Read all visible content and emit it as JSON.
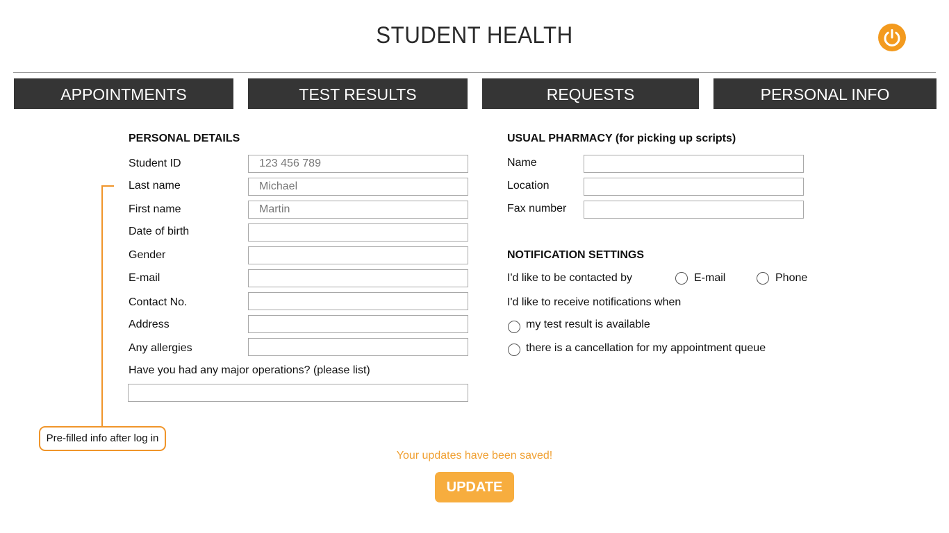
{
  "header": {
    "title": "STUDENT HEALTH",
    "power_icon": "power-icon",
    "accent_color": "#f39a1e"
  },
  "nav": {
    "tabs": [
      {
        "label": "APPOINTMENTS"
      },
      {
        "label": "TEST RESULTS"
      },
      {
        "label": "REQUESTS"
      },
      {
        "label": "PERSONAL INFO"
      }
    ]
  },
  "personal": {
    "heading": "PERSONAL DETAILS",
    "fields": [
      {
        "label": "Student ID",
        "value": "123 456 789"
      },
      {
        "label": "Last name",
        "value": "Michael"
      },
      {
        "label": "First name",
        "value": "Martin"
      },
      {
        "label": "Date of birth",
        "value": ""
      },
      {
        "label": "Gender",
        "value": ""
      },
      {
        "label": "E-mail",
        "value": ""
      },
      {
        "label": "Contact No.",
        "value": ""
      },
      {
        "label": "Address",
        "value": ""
      },
      {
        "label": "Any allergies",
        "value": ""
      }
    ],
    "operations_label": "Have you had any major operations? (please list)",
    "operations_value": ""
  },
  "pharmacy": {
    "heading": "USUAL PHARMACY (for picking up scripts)",
    "fields": [
      {
        "label": "Name",
        "value": ""
      },
      {
        "label": "Location",
        "value": ""
      },
      {
        "label": "Fax number",
        "value": ""
      }
    ]
  },
  "notifications": {
    "heading": "NOTIFICATION SETTINGS",
    "contact_label": "I'd like to be contacted by",
    "contact_options": [
      "E-mail",
      "Phone"
    ],
    "receive_label": "I'd like to receive notifications when",
    "receive_options": [
      "my test result is available",
      "there is a cancellation for my appointment queue"
    ]
  },
  "callout": {
    "text": "Pre-filled info after log in"
  },
  "footer": {
    "saved_message": "Your updates have been saved!",
    "update_label": "UPDATE"
  }
}
